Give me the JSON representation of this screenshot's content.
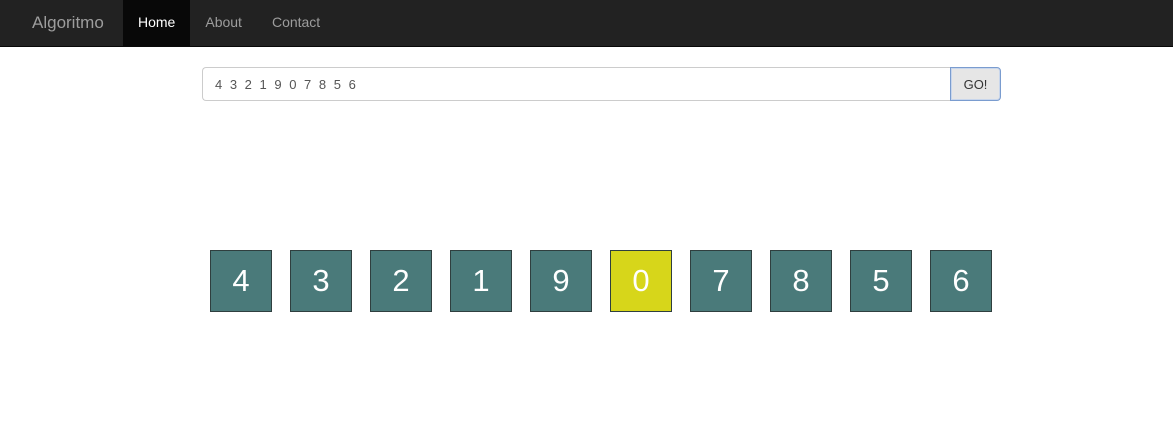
{
  "navbar": {
    "brand": "Algoritmo",
    "items": [
      {
        "label": "Home",
        "active": true
      },
      {
        "label": "About",
        "active": false
      },
      {
        "label": "Contact",
        "active": false
      }
    ]
  },
  "search": {
    "value": "4 3 2 1 9 0 7 8 5 6",
    "button_label": "GO!"
  },
  "colors": {
    "box_default": "#4a7a7a",
    "box_highlight": "#d7d61a"
  },
  "boxes": [
    {
      "value": "4",
      "highlighted": false
    },
    {
      "value": "3",
      "highlighted": false
    },
    {
      "value": "2",
      "highlighted": false
    },
    {
      "value": "1",
      "highlighted": false
    },
    {
      "value": "9",
      "highlighted": false
    },
    {
      "value": "0",
      "highlighted": true
    },
    {
      "value": "7",
      "highlighted": false
    },
    {
      "value": "8",
      "highlighted": false
    },
    {
      "value": "5",
      "highlighted": false
    },
    {
      "value": "6",
      "highlighted": false
    }
  ]
}
